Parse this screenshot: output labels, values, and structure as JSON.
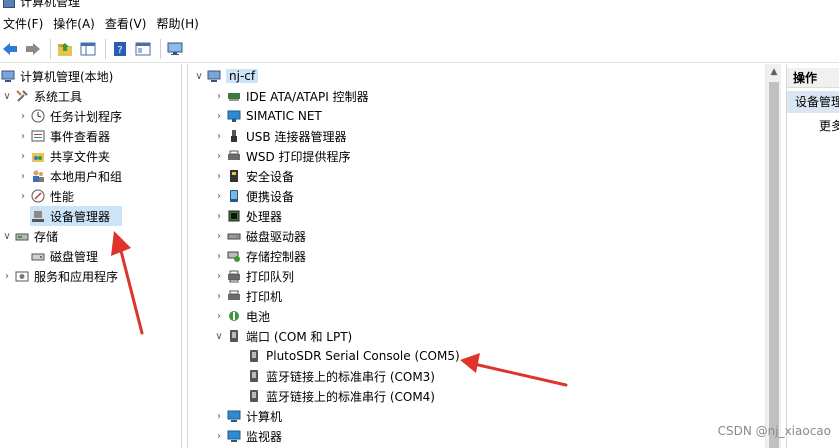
{
  "window": {
    "title": "计算机管理"
  },
  "menu": [
    "文件(F)",
    "操作(A)",
    "查看(V)",
    "帮助(H)"
  ],
  "toolbar": {
    "buttons": [
      "back-icon",
      "forward-icon",
      "up-folder-icon",
      "show-hide-console-tree-icon",
      "help-icon",
      "properties-icon",
      "monitor-icon"
    ]
  },
  "tree": {
    "root": "计算机管理(本地)",
    "system_tools": "系统工具",
    "task_scheduler": "任务计划程序",
    "event_viewer": "事件查看器",
    "shared_folders": "共享文件夹",
    "local_users": "本地用户和组",
    "performance": "性能",
    "device_manager": "设备管理器",
    "storage": "存储",
    "disk_management": "磁盘管理",
    "services_apps": "服务和应用程序"
  },
  "devices": {
    "root": "nj-cf",
    "categories": [
      "IDE ATA/ATAPI 控制器",
      "SIMATIC NET",
      "USB 连接器管理器",
      "WSD 打印提供程序",
      "安全设备",
      "便携设备",
      "处理器",
      "磁盘驱动器",
      "存储控制器",
      "打印队列",
      "打印机",
      "电池"
    ],
    "ports": "端口 (COM 和 LPT)",
    "port_items": [
      "PlutoSDR Serial Console (COM5)",
      "蓝牙链接上的标准串行 (COM3)",
      "蓝牙链接上的标准串行 (COM4)"
    ],
    "after": [
      "计算机",
      "监视器"
    ]
  },
  "actions": {
    "header": "操作",
    "selected": "设备管理器",
    "more": "更多操作"
  },
  "watermark": "CSDN @nj_xiaocao",
  "colors": {
    "arrow": "#e0332b",
    "selection": "#cce4f7"
  }
}
